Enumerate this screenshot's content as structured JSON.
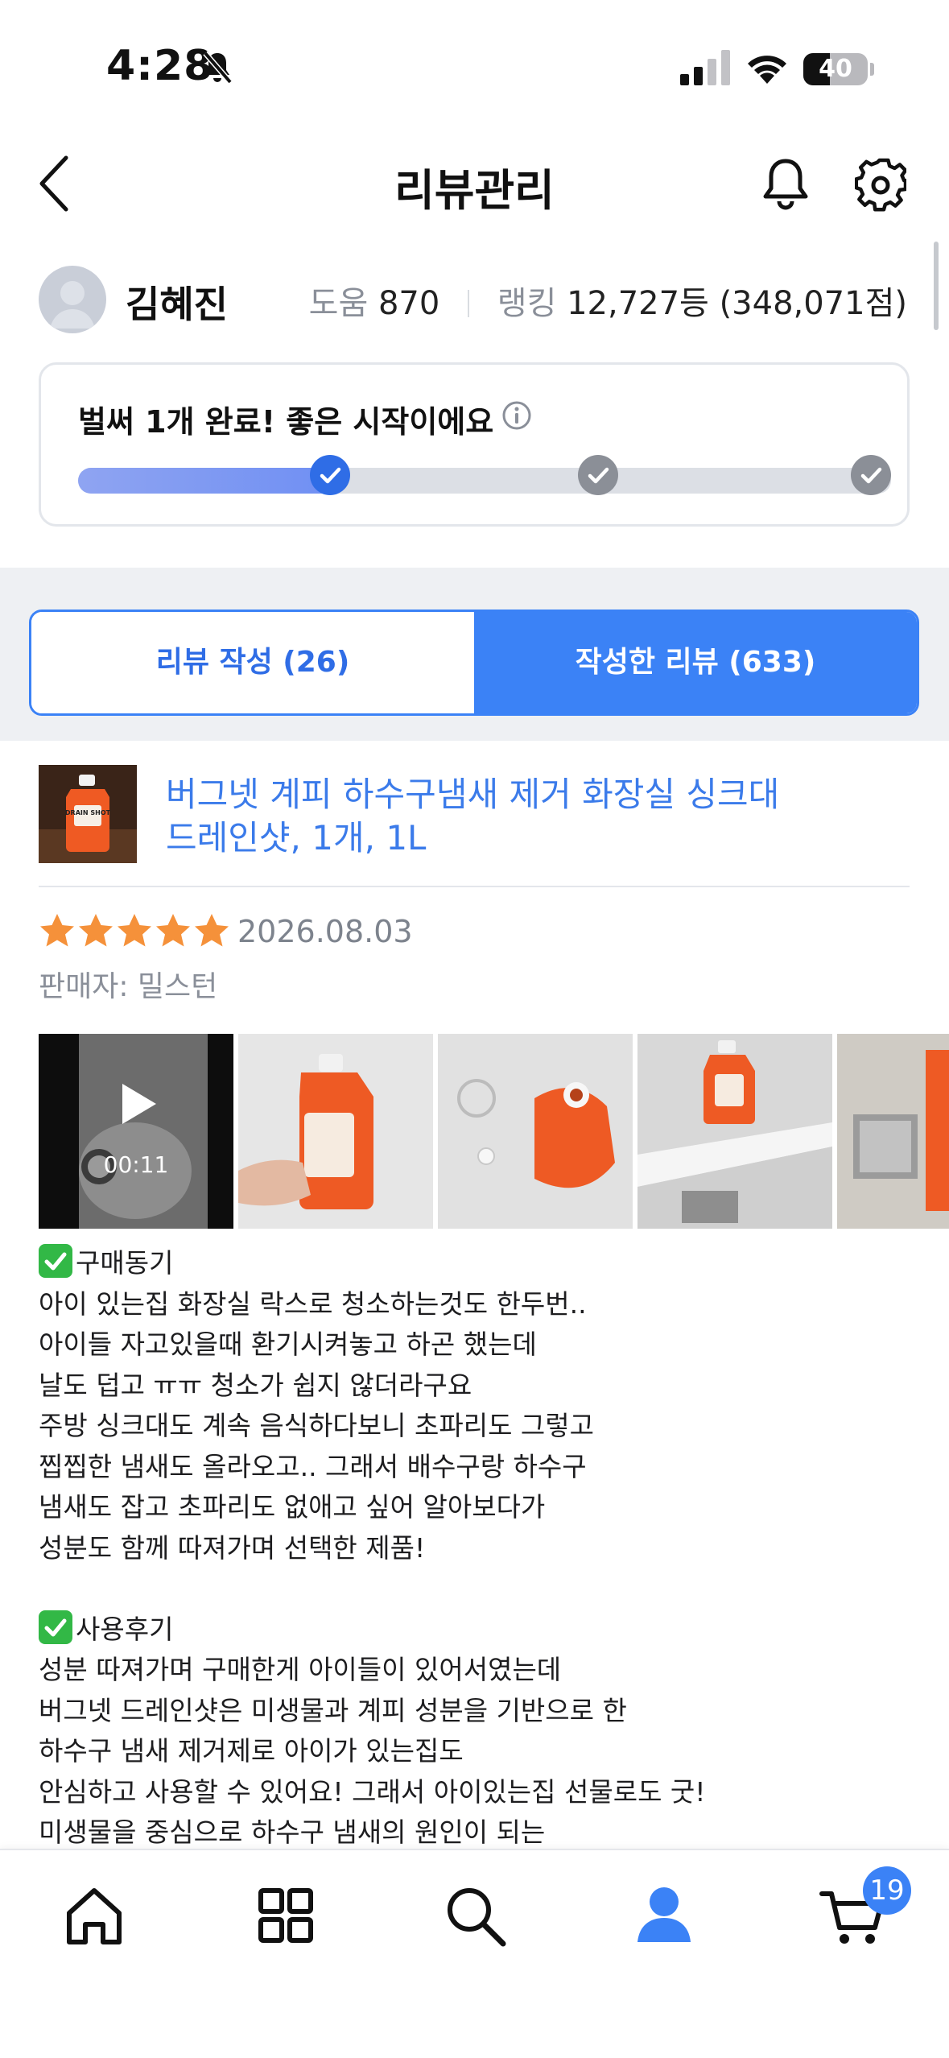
{
  "status_bar": {
    "time": "4:28",
    "battery": "40",
    "icons": [
      "bell-off-icon",
      "cellular-signal-icon",
      "wifi-icon",
      "battery-icon"
    ]
  },
  "header": {
    "title": "리뷰관리",
    "icons": [
      "chevron-left-icon",
      "bell-icon",
      "gear-icon"
    ]
  },
  "profile": {
    "name": "김혜진",
    "help_label": "도움",
    "help_value": "870",
    "ranking_label": "랭킹",
    "ranking_value": "12,727등 (348,071점)"
  },
  "progress": {
    "message": "벌써 1개 완료! 좋은 시작이에요",
    "steps_total": 3,
    "steps_completed": 1,
    "fill_fraction": 0.32,
    "colors": {
      "fill": "#7b96f2",
      "active_step": "#2f6de6",
      "inactive_step": "#8b8f97"
    }
  },
  "tabs": [
    {
      "label": "리뷰 작성 (26)",
      "selected": false
    },
    {
      "label": "작성한 리뷰 (633)",
      "selected": true
    }
  ],
  "product": {
    "title_line1": "버그넷 계피 하수구냄새 제거 화장실 싱크대",
    "title_line2": "드레인샷, 1개, 1L",
    "thumb_text": "DRAIN SHOT"
  },
  "review": {
    "rating": 5,
    "max_rating": 5,
    "date": "2026.08.03",
    "seller": "판매자: 밀스턴",
    "video_duration": "00:11",
    "lines": [
      "구매동기",
      "아이 있는집 화장실 락스로 청소하는것도 한두번..",
      "아이들 자고있을때 환기시켜놓고 하곤 했는데",
      "날도 덥고 ㅠㅠ 청소가 쉽지 않더라구요",
      "주방 싱크대도 계속 음식하다보니 초파리도 그렇고",
      "찝찝한 냄새도 올라오고.. 그래서 배수구랑 하수구",
      "냄새도 잡고 초파리도 없애고 싶어 알아보다가",
      "성분도 함께 따져가며 선택한 제품!",
      "",
      "사용후기",
      "성분 따져가며 구매한게 아이들이 있어서였는데",
      "버그넷 드레인샷은 미생물과 계피 성분을 기반으로 한",
      "하수구 냄새 제거제로 아이가 있는집도",
      "안심하고 사용할 수 있어요! 그래서 아이있는집 선물로도 굿!",
      "미생물을 중심으로 하수구 냄새의 원인이 되는"
    ],
    "checkmark_lines": [
      0,
      9
    ],
    "colors": {
      "star": "#f5913a",
      "check": "#32b846"
    }
  },
  "bottom_nav": {
    "items": [
      "home-icon",
      "grid-icon",
      "search-icon",
      "profile-icon",
      "cart-icon"
    ],
    "active": "profile-icon",
    "cart_badge": "19"
  }
}
